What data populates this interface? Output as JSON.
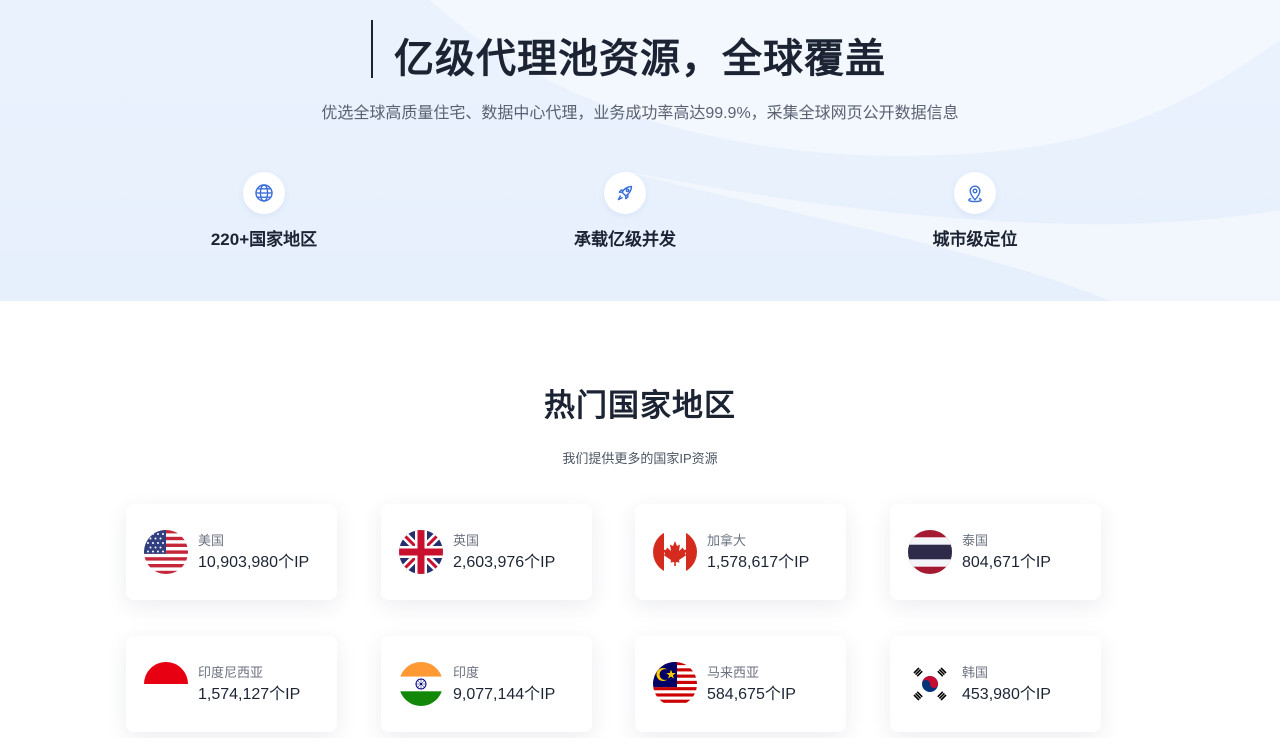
{
  "hero": {
    "title": "亿级代理池资源，全球覆盖",
    "subtitle": "优选全球高质量住宅、数据中心代理，业务成功率高达99.9%，采集全球网页公开数据信息",
    "features": [
      {
        "label": "220+国家地区",
        "icon": "globe-icon"
      },
      {
        "label": "承载亿级并发",
        "icon": "rocket-icon"
      },
      {
        "label": "城市级定位",
        "icon": "location-pin-icon"
      }
    ],
    "accent_color": "#3b6fd8"
  },
  "regions": {
    "title": "热门国家地区",
    "subtitle": "我们提供更多的国家IP资源",
    "countries": [
      {
        "name": "美国",
        "count": "10,903,980个IP",
        "flag": "us-flag-icon"
      },
      {
        "name": "英国",
        "count": "2,603,976个IP",
        "flag": "uk-flag-icon"
      },
      {
        "name": "加拿大",
        "count": "1,578,617个IP",
        "flag": "canada-flag-icon"
      },
      {
        "name": "泰国",
        "count": "804,671个IP",
        "flag": "thailand-flag-icon"
      },
      {
        "name": "印度尼西亚",
        "count": "1,574,127个IP",
        "flag": "indonesia-flag-icon"
      },
      {
        "name": "印度",
        "count": "9,077,144个IP",
        "flag": "india-flag-icon"
      },
      {
        "name": "马来西亚",
        "count": "584,675个IP",
        "flag": "malaysia-flag-icon"
      },
      {
        "name": "韩国",
        "count": "453,980个IP",
        "flag": "korea-flag-icon"
      }
    ]
  }
}
